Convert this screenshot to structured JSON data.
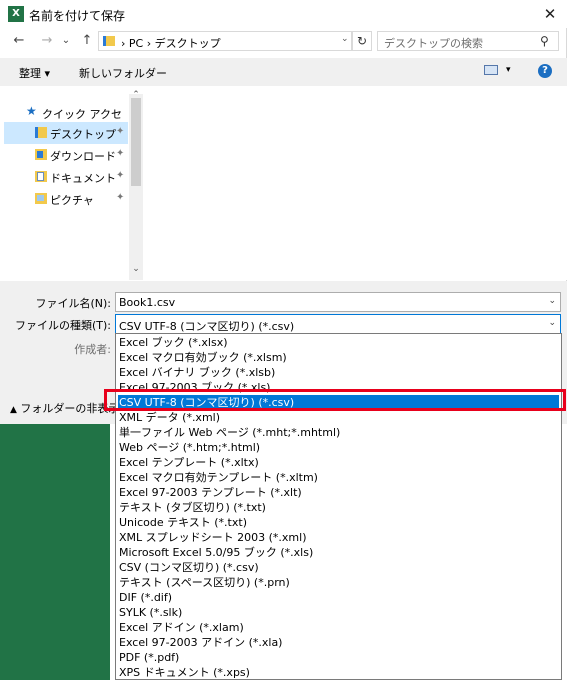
{
  "window": {
    "title": "名前を付けて保存",
    "app_icon_letter": "X",
    "close_glyph": "✕"
  },
  "nav_buttons": {
    "back": "←",
    "forward": "→",
    "recent": "⌄",
    "up": "↑"
  },
  "address": {
    "root": "PC",
    "sep1": "›",
    "sep0": "›",
    "folder": "デスクトップ",
    "dropdown": "⌄",
    "refresh": "↻"
  },
  "search": {
    "placeholder": "デスクトップの検索",
    "icon": "⚲"
  },
  "toolbar": {
    "organize": "整理 ▾",
    "new_folder": "新しいフォルダー",
    "view_dd": "▾",
    "help": "?"
  },
  "sidebar": {
    "quick_access": "クイック アクセス",
    "items": [
      {
        "label": "デスクトップ",
        "pin": "📌"
      },
      {
        "label": "ダウンロード",
        "pin": "📌"
      },
      {
        "label": "ドキュメント",
        "pin": "📌"
      },
      {
        "label": "ピクチャ",
        "pin": "📌"
      }
    ],
    "scroll_up": "⌃",
    "scroll_down": "⌄"
  },
  "form": {
    "filename_label": "ファイル名(N):",
    "filename_value": "Book1.csv",
    "filetype_label": "ファイルの種類(T):",
    "filetype_value": "CSV UTF-8 (コンマ区切り) (*.csv)",
    "author_label": "作成者:",
    "dd_glyph": "⌄",
    "hide_folders": "フォルダーの非表示"
  },
  "dropdown_options": [
    "Excel ブック (*.xlsx)",
    "Excel マクロ有効ブック (*.xlsm)",
    "Excel バイナリ ブック (*.xlsb)",
    "Excel 97-2003 ブック (*.xls)",
    "CSV UTF-8 (コンマ区切り) (*.csv)",
    "XML データ (*.xml)",
    "単一ファイル Web ページ (*.mht;*.mhtml)",
    "Web ページ (*.htm;*.html)",
    "Excel テンプレート (*.xltx)",
    "Excel マクロ有効テンプレート (*.xltm)",
    "Excel 97-2003 テンプレート (*.xlt)",
    "テキスト (タブ区切り) (*.txt)",
    "Unicode テキスト (*.txt)",
    "XML スプレッドシート 2003 (*.xml)",
    "Microsoft Excel 5.0/95 ブック (*.xls)",
    "CSV (コンマ区切り) (*.csv)",
    "テキスト (スペース区切り) (*.prn)",
    "DIF (*.dif)",
    "SYLK (*.slk)",
    "Excel アドイン (*.xlam)",
    "Excel 97-2003 アドイン (*.xla)",
    "PDF (*.pdf)",
    "XPS ドキュメント (*.xps)"
  ],
  "selected_option_index": 4,
  "colors": {
    "excel_green": "#217346",
    "selection": "#0078d7",
    "highlight_border": "#e8001c"
  }
}
